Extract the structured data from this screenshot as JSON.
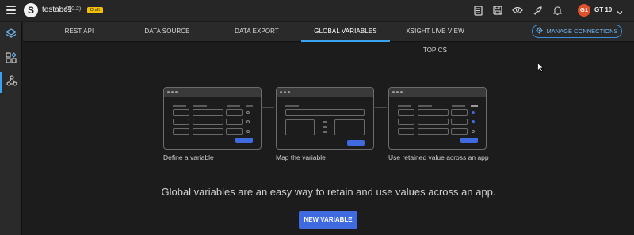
{
  "app": {
    "name": "testabc1",
    "version": "(1.0.2)",
    "status_badge": "Draft"
  },
  "toolbar": {
    "icons": [
      "document-icon",
      "save-icon",
      "preview-eye-icon",
      "rocket-icon",
      "bell-icon"
    ]
  },
  "user": {
    "initials": "G1",
    "name": "GT 10"
  },
  "sidebar": {
    "items": [
      {
        "icon": "layers-icon",
        "active": false
      },
      {
        "icon": "components-grid-icon",
        "active": false
      },
      {
        "icon": "share-nodes-icon",
        "active": true
      }
    ]
  },
  "tabs": [
    {
      "label": "REST API",
      "active": false
    },
    {
      "label": "DATA SOURCE",
      "active": false
    },
    {
      "label": "DATA EXPORT",
      "active": false
    },
    {
      "label": "GLOBAL VARIABLES",
      "active": true
    },
    {
      "label": "XSIGHT LIVE VIEW TOPICS",
      "active": false
    }
  ],
  "manage_connections": {
    "label": "MANAGE CONNECTIONS",
    "icon": "gear-icon"
  },
  "steps": [
    {
      "caption": "Define a variable"
    },
    {
      "caption": "Map the variable"
    },
    {
      "caption": "Use retained value across an app"
    }
  ],
  "empty_state": {
    "message": "Global variables are an easy way to retain and use values across an app.",
    "button_label": "NEW VARIABLE"
  },
  "colors": {
    "accent": "#3aa3f0",
    "primary_button": "#3f6ae0",
    "badge": "#f3c000",
    "avatar": "#e0502a",
    "background": "#1c1c1c"
  }
}
